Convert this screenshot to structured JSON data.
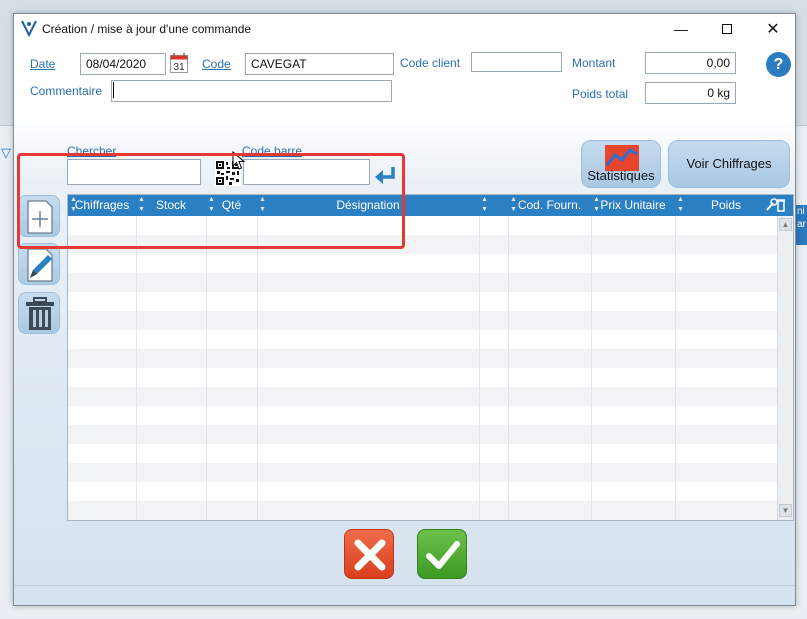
{
  "window": {
    "title": "Création / mise à jour d'une commande",
    "minimize": "—",
    "close": "✕"
  },
  "form": {
    "date_label": "Date",
    "date_value": "08/04/2020",
    "calendar_day": "31",
    "code_label": "Code",
    "code_value": "CAVEGAT",
    "code_client_label": "Code client",
    "code_client_value": "",
    "montant_label": "Montant",
    "montant_value": "0,00",
    "poids_total_label": "Poids total",
    "poids_total_value": "0 kg",
    "commentaire_label": "Commentaire",
    "commentaire_value": "",
    "help": "?"
  },
  "search": {
    "chercher_label": "Chercher",
    "chercher_value": "",
    "code_barre_label": "Code barre",
    "code_barre_value": ""
  },
  "buttons": {
    "statistiques": "Statistiques",
    "voir_chiffrages": "Voir Chiffrages"
  },
  "grid": {
    "columns": [
      "Chiffrages",
      "Stock",
      "Qté",
      "Désignation",
      "",
      "Cod. Fourn.",
      "Prix Unitaire",
      "Poids"
    ],
    "rows": []
  },
  "background": {
    "right_strip_text": "ni ar"
  },
  "colors": {
    "accent": "#2b7fc3",
    "label": "#2a6fb0",
    "highlight": "#e53935",
    "cancel": "#d93f1f",
    "ok": "#3d9a25"
  }
}
